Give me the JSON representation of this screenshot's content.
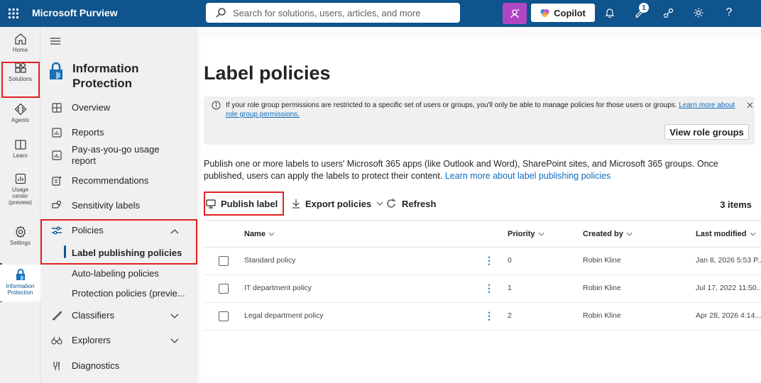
{
  "app": {
    "title": "Microsoft Purview"
  },
  "search": {
    "placeholder": "Search for solutions, users, articles, and more"
  },
  "topbar": {
    "copilot_label": "Copilot",
    "notification_count": "1"
  },
  "rail": {
    "items": [
      {
        "label": "Home",
        "icon": "home-icon"
      },
      {
        "label": "Solutions",
        "icon": "solutions-icon"
      },
      {
        "label": "Agents",
        "icon": "agents-icon"
      },
      {
        "label": "Learn",
        "icon": "learn-icon"
      },
      {
        "label": "Usage center (preview)",
        "icon": "usage-icon"
      },
      {
        "label": "Settings",
        "icon": "settings-icon"
      },
      {
        "label": "Information Protection",
        "icon": "info-protection-icon"
      }
    ]
  },
  "nav": {
    "title": "Information Protection",
    "items": [
      {
        "label": "Overview",
        "icon": "overview-icon"
      },
      {
        "label": "Reports",
        "icon": "reports-icon"
      },
      {
        "label": "Pay-as-you-go usage report",
        "icon": "payg-icon"
      },
      {
        "label": "Recommendations",
        "icon": "recommendations-icon"
      },
      {
        "label": "Sensitivity labels",
        "icon": "sensitivity-labels-icon"
      },
      {
        "label": "Policies",
        "icon": "policies-icon"
      },
      {
        "label": "Classifiers",
        "icon": "classifiers-icon"
      },
      {
        "label": "Explorers",
        "icon": "explorers-icon"
      },
      {
        "label": "Diagnostics",
        "icon": "diagnostics-icon"
      }
    ],
    "policies_sub": [
      {
        "label": "Label publishing policies"
      },
      {
        "label": "Auto-labeling policies"
      },
      {
        "label": "Protection policies (previe..."
      }
    ]
  },
  "main": {
    "title": "Label policies",
    "info": {
      "text": "If your role group permissions are restricted to a specific set of users or groups, you'll only be able to manage policies for those users or groups.",
      "link": "Learn more about role group permissions.",
      "button": "View role groups"
    },
    "description": "Publish one or more labels to users' Microsoft 365 apps (like Outlook and Word), SharePoint sites, and Microsoft 365 groups. Once published, users can apply the labels to protect their content.",
    "description_link": "Learn more about label publishing policies",
    "toolbar": {
      "publish": "Publish label",
      "export": "Export policies",
      "refresh": "Refresh",
      "count": "3 items"
    },
    "table": {
      "columns": [
        "Name",
        "Priority",
        "Created by",
        "Last modified"
      ],
      "rows": [
        {
          "name": "Standard policy",
          "priority": "0",
          "created_by": "Robin Kline",
          "modified": "Jan 8, 2026 5:53 P..."
        },
        {
          "name": "IT department policy",
          "priority": "1",
          "created_by": "Robin Kline",
          "modified": "Jul 17, 2022 11:50..."
        },
        {
          "name": "Legal department policy",
          "priority": "2",
          "created_by": "Robin Kline",
          "modified": "Apr 28, 2026 4:14..."
        }
      ]
    }
  },
  "colors": {
    "brand": "#0f548c",
    "highlight": "#e0211f",
    "copilot_accent": "#b146c2",
    "link": "#0f6cbd"
  }
}
